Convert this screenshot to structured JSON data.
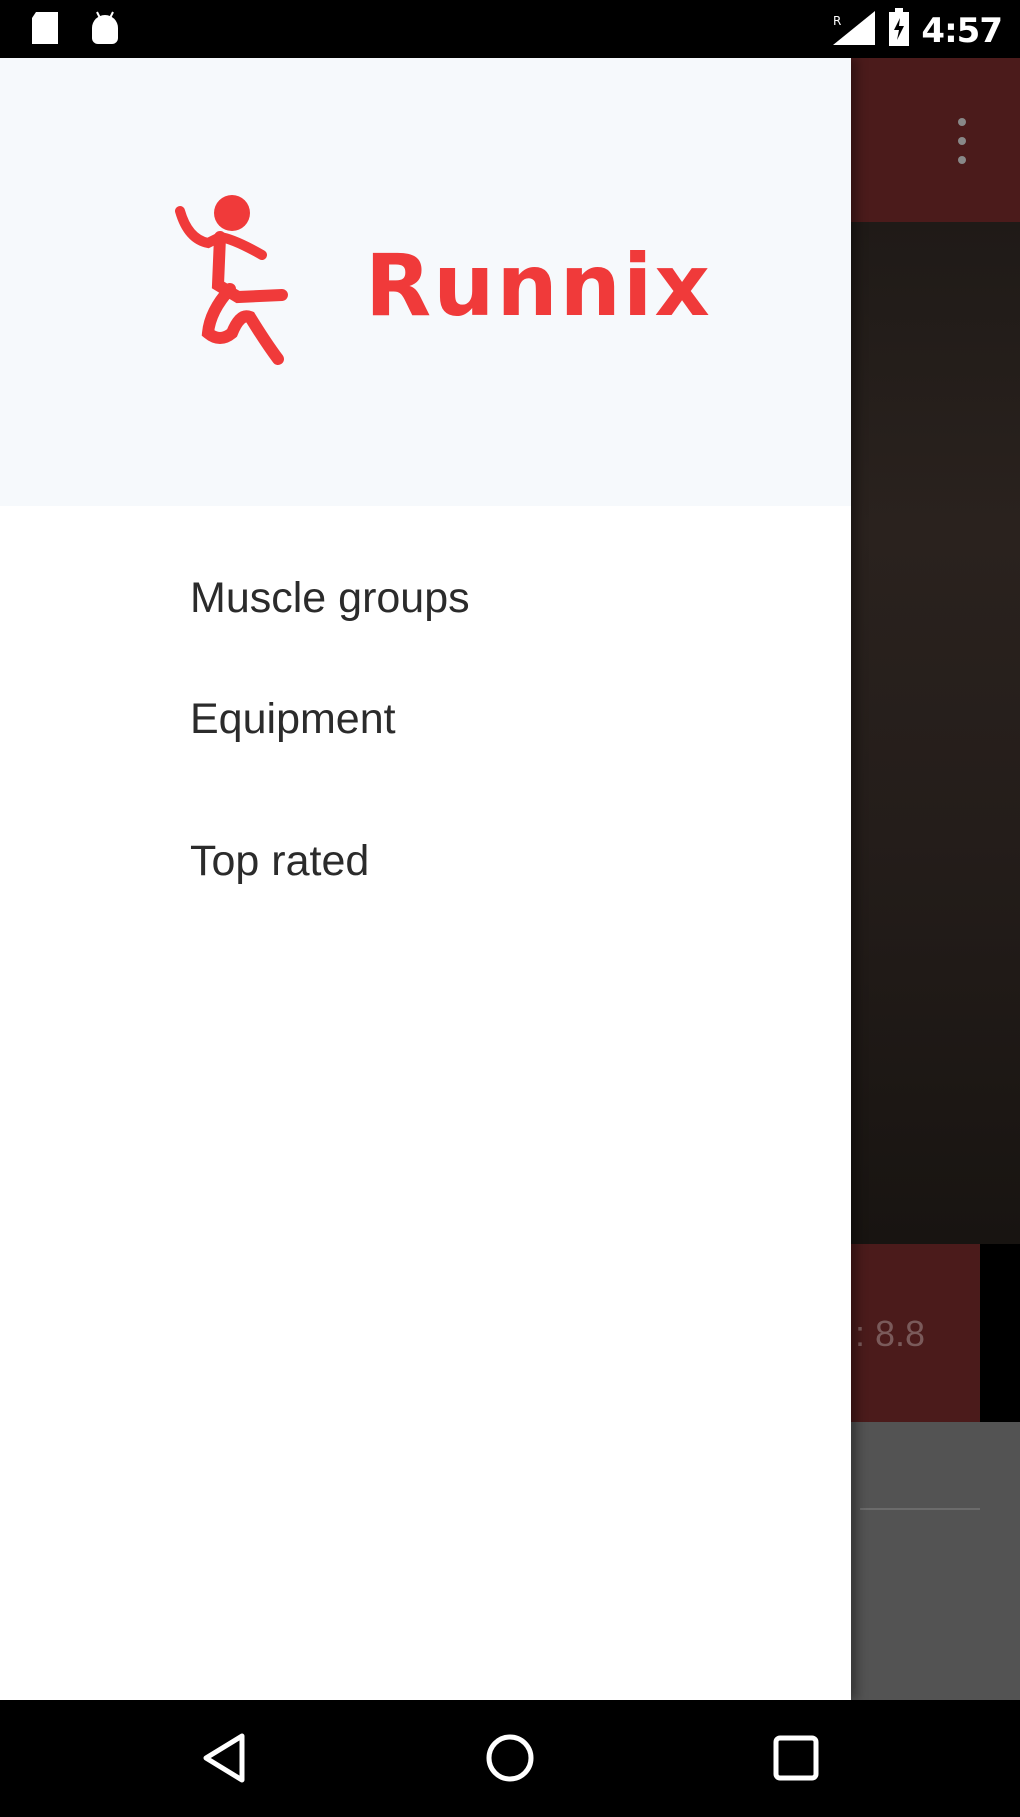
{
  "status_bar": {
    "time": "4:57",
    "left_icons": [
      "sd-card-icon",
      "android-icon"
    ],
    "right_icons": [
      "signal-icon",
      "battery-icon"
    ]
  },
  "background_app": {
    "toolbar_color": "#4b1b1b",
    "card_text": ": 8.8"
  },
  "drawer": {
    "brand_name": "Runnix",
    "brand_color": "#f03a3a",
    "logo_icon": "runner-icon",
    "menu_items": [
      {
        "label": "Muscle groups"
      },
      {
        "label": "Equipment"
      },
      {
        "label": "Top rated"
      }
    ]
  },
  "nav_bar": {
    "buttons": [
      "back-icon",
      "home-icon",
      "recents-icon"
    ]
  }
}
